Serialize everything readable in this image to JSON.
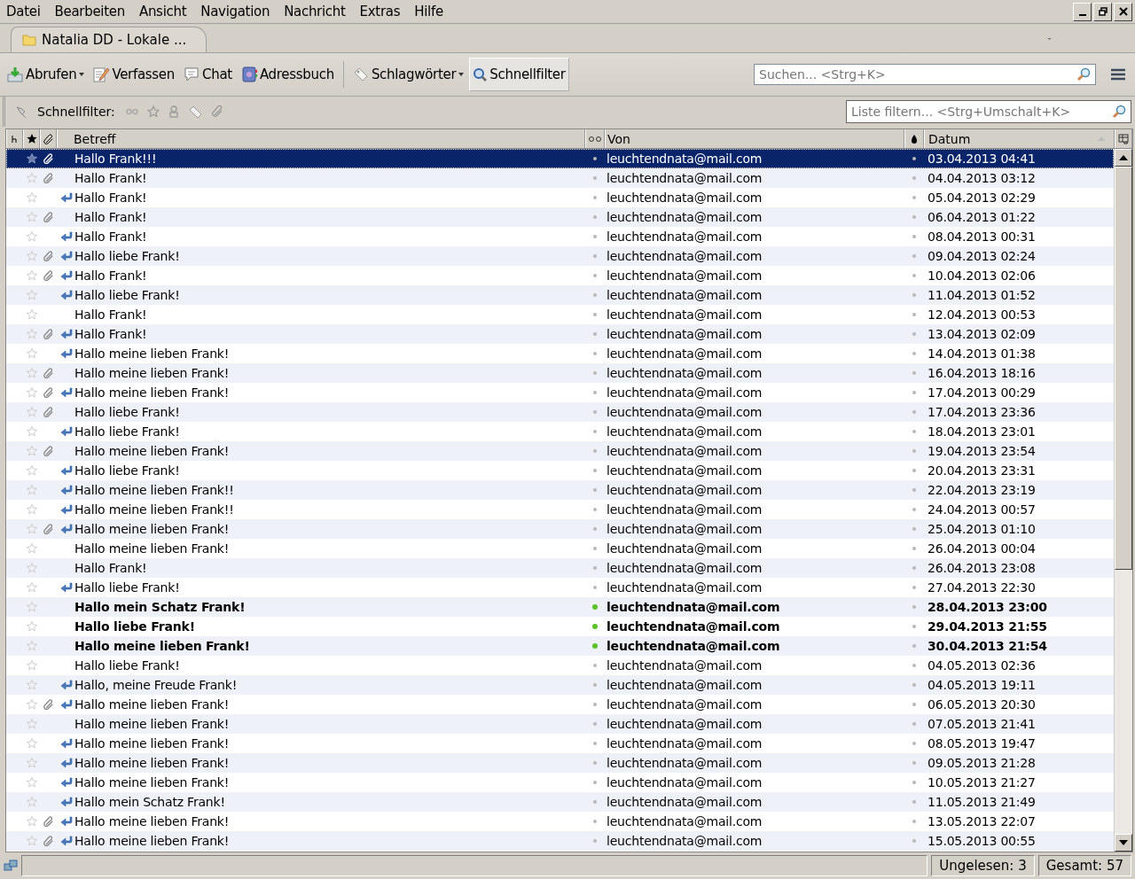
{
  "menu": [
    "Datei",
    "Bearbeiten",
    "Ansicht",
    "Navigation",
    "Nachricht",
    "Extras",
    "Hilfe"
  ],
  "tabs": [
    {
      "label": "Natalia DD - Lokale ...",
      "selected": true
    }
  ],
  "toolbar": [
    {
      "label": "Abrufen",
      "kind": "download",
      "dropdown": true
    },
    {
      "label": "Verfassen",
      "kind": "compose",
      "dropdown": false
    },
    {
      "label": "Chat",
      "kind": "chat",
      "dropdown": false
    },
    {
      "label": "Adressbuch",
      "kind": "addressbook",
      "dropdown": false
    },
    {
      "label": "Schlagwörter",
      "kind": "tag",
      "dropdown": true
    },
    {
      "label": "Schnellfilter",
      "kind": "search",
      "dropdown": false,
      "pressed": true
    }
  ],
  "search": {
    "placeholder": "Suchen... <Strg+K>"
  },
  "quick_filter": {
    "label": "Schnellfilter:",
    "placeholder": "Liste filtern... <Strg+Umschalt+K>"
  },
  "columns": {
    "subject": "Betreff",
    "from": "Von",
    "date": "Datum"
  },
  "rows": [
    {
      "subject": "Hallo Frank!!!",
      "attachment": true,
      "replied": false,
      "unread": false,
      "from": "leuchtendnata@mail.com",
      "date": "03.04.2013 04:41",
      "selected": true
    },
    {
      "subject": "Hallo Frank!",
      "attachment": true,
      "replied": false,
      "unread": false,
      "from": "leuchtendnata@mail.com",
      "date": "04.04.2013 03:12",
      "selected": false
    },
    {
      "subject": "Hallo Frank!",
      "attachment": false,
      "replied": true,
      "unread": false,
      "from": "leuchtendnata@mail.com",
      "date": "05.04.2013 02:29",
      "selected": false
    },
    {
      "subject": "Hallo Frank!",
      "attachment": true,
      "replied": false,
      "unread": false,
      "from": "leuchtendnata@mail.com",
      "date": "06.04.2013 01:22",
      "selected": false
    },
    {
      "subject": "Hallo Frank!",
      "attachment": false,
      "replied": true,
      "unread": false,
      "from": "leuchtendnata@mail.com",
      "date": "08.04.2013 00:31",
      "selected": false
    },
    {
      "subject": "Hallo liebe Frank!",
      "attachment": true,
      "replied": true,
      "unread": false,
      "from": "leuchtendnata@mail.com",
      "date": "09.04.2013 02:24",
      "selected": false
    },
    {
      "subject": "Hallo Frank!",
      "attachment": true,
      "replied": true,
      "unread": false,
      "from": "leuchtendnata@mail.com",
      "date": "10.04.2013 02:06",
      "selected": false
    },
    {
      "subject": "Hallo liebe Frank!",
      "attachment": false,
      "replied": true,
      "unread": false,
      "from": "leuchtendnata@mail.com",
      "date": "11.04.2013 01:52",
      "selected": false
    },
    {
      "subject": "Hallo Frank!",
      "attachment": false,
      "replied": false,
      "unread": false,
      "from": "leuchtendnata@mail.com",
      "date": "12.04.2013 00:53",
      "selected": false
    },
    {
      "subject": "Hallo Frank!",
      "attachment": true,
      "replied": true,
      "unread": false,
      "from": "leuchtendnata@mail.com",
      "date": "13.04.2013 02:09",
      "selected": false
    },
    {
      "subject": "Hallo meine lieben Frank!",
      "attachment": false,
      "replied": true,
      "unread": false,
      "from": "leuchtendnata@mail.com",
      "date": "14.04.2013 01:38",
      "selected": false
    },
    {
      "subject": "Hallo meine lieben Frank!",
      "attachment": true,
      "replied": false,
      "unread": false,
      "from": "leuchtendnata@mail.com",
      "date": "16.04.2013 18:16",
      "selected": false
    },
    {
      "subject": "Hallo meine lieben Frank!",
      "attachment": true,
      "replied": true,
      "unread": false,
      "from": "leuchtendnata@mail.com",
      "date": "17.04.2013 00:29",
      "selected": false
    },
    {
      "subject": "Hallo liebe Frank!",
      "attachment": true,
      "replied": false,
      "unread": false,
      "from": "leuchtendnata@mail.com",
      "date": "17.04.2013 23:36",
      "selected": false
    },
    {
      "subject": "Hallo liebe Frank!",
      "attachment": false,
      "replied": true,
      "unread": false,
      "from": "leuchtendnata@mail.com",
      "date": "18.04.2013 23:01",
      "selected": false
    },
    {
      "subject": "Hallo meine lieben Frank!",
      "attachment": true,
      "replied": false,
      "unread": false,
      "from": "leuchtendnata@mail.com",
      "date": "19.04.2013 23:54",
      "selected": false
    },
    {
      "subject": "Hallo liebe Frank!",
      "attachment": false,
      "replied": true,
      "unread": false,
      "from": "leuchtendnata@mail.com",
      "date": "20.04.2013 23:31",
      "selected": false
    },
    {
      "subject": "Hallo meine lieben Frank!!",
      "attachment": false,
      "replied": true,
      "unread": false,
      "from": "leuchtendnata@mail.com",
      "date": "22.04.2013 23:19",
      "selected": false
    },
    {
      "subject": "Hallo meine lieben Frank!!",
      "attachment": false,
      "replied": true,
      "unread": false,
      "from": "leuchtendnata@mail.com",
      "date": "24.04.2013 00:57",
      "selected": false
    },
    {
      "subject": "Hallo meine lieben Frank!",
      "attachment": true,
      "replied": true,
      "unread": false,
      "from": "leuchtendnata@mail.com",
      "date": "25.04.2013 01:10",
      "selected": false
    },
    {
      "subject": "Hallo meine lieben Frank!",
      "attachment": false,
      "replied": false,
      "unread": false,
      "from": "leuchtendnata@mail.com",
      "date": "26.04.2013 00:04",
      "selected": false
    },
    {
      "subject": "Hallo Frank!",
      "attachment": false,
      "replied": false,
      "unread": false,
      "from": "leuchtendnata@mail.com",
      "date": "26.04.2013 23:08",
      "selected": false
    },
    {
      "subject": "Hallo liebe Frank!",
      "attachment": false,
      "replied": true,
      "unread": false,
      "from": "leuchtendnata@mail.com",
      "date": "27.04.2013 22:30",
      "selected": false
    },
    {
      "subject": "Hallo mein Schatz Frank!",
      "attachment": false,
      "replied": false,
      "unread": true,
      "from": "leuchtendnata@mail.com",
      "date": "28.04.2013 23:00",
      "selected": false
    },
    {
      "subject": "Hallo liebe Frank!",
      "attachment": false,
      "replied": false,
      "unread": true,
      "from": "leuchtendnata@mail.com",
      "date": "29.04.2013 21:55",
      "selected": false
    },
    {
      "subject": "Hallo meine lieben Frank!",
      "attachment": false,
      "replied": false,
      "unread": true,
      "from": "leuchtendnata@mail.com",
      "date": "30.04.2013 21:54",
      "selected": false
    },
    {
      "subject": "Hallo liebe Frank!",
      "attachment": false,
      "replied": false,
      "unread": false,
      "from": "leuchtendnata@mail.com",
      "date": "04.05.2013 02:36",
      "selected": false
    },
    {
      "subject": "Hallo, meine Freude Frank!",
      "attachment": false,
      "replied": true,
      "unread": false,
      "from": "leuchtendnata@mail.com",
      "date": "04.05.2013 19:11",
      "selected": false
    },
    {
      "subject": "Hallo meine lieben Frank!",
      "attachment": true,
      "replied": true,
      "unread": false,
      "from": "leuchtendnata@mail.com",
      "date": "06.05.2013 20:30",
      "selected": false
    },
    {
      "subject": "Hallo meine lieben Frank!",
      "attachment": false,
      "replied": false,
      "unread": false,
      "from": "leuchtendnata@mail.com",
      "date": "07.05.2013 21:41",
      "selected": false
    },
    {
      "subject": "Hallo meine lieben Frank!",
      "attachment": false,
      "replied": true,
      "unread": false,
      "from": "leuchtendnata@mail.com",
      "date": "08.05.2013 19:47",
      "selected": false
    },
    {
      "subject": "Hallo meine lieben Frank!",
      "attachment": false,
      "replied": true,
      "unread": false,
      "from": "leuchtendnata@mail.com",
      "date": "09.05.2013 21:28",
      "selected": false
    },
    {
      "subject": "Hallo meine lieben Frank!",
      "attachment": false,
      "replied": true,
      "unread": false,
      "from": "leuchtendnata@mail.com",
      "date": "10.05.2013 21:27",
      "selected": false
    },
    {
      "subject": "Hallo mein Schatz Frank!",
      "attachment": false,
      "replied": true,
      "unread": false,
      "from": "leuchtendnata@mail.com",
      "date": "11.05.2013 21:49",
      "selected": false
    },
    {
      "subject": "Hallo meine lieben Frank!",
      "attachment": true,
      "replied": true,
      "unread": false,
      "from": "leuchtendnata@mail.com",
      "date": "13.05.2013 22:07",
      "selected": false
    },
    {
      "subject": "Hallo meine lieben Frank!",
      "attachment": true,
      "replied": true,
      "unread": false,
      "from": "leuchtendnata@mail.com",
      "date": "15.05.2013 00:55",
      "selected": false
    }
  ],
  "status_bar": {
    "unread": "Ungelesen: 3",
    "total": "Gesamt: 57"
  }
}
